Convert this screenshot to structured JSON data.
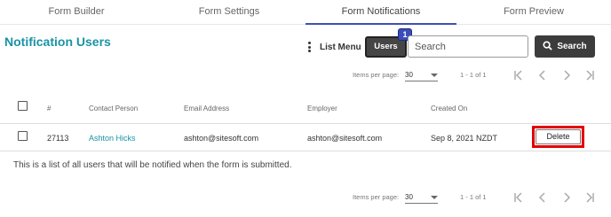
{
  "tabs": [
    {
      "label": "Form Builder",
      "active": false
    },
    {
      "label": "Form Settings",
      "active": false
    },
    {
      "label": "Form Notifications",
      "active": true
    },
    {
      "label": "Form Preview",
      "active": false
    }
  ],
  "page": {
    "title": "Notification Users"
  },
  "toolbar": {
    "list_menu_label": "List Menu",
    "users_label": "Users",
    "users_badge": "1",
    "search_placeholder": "Search",
    "search_value": "",
    "search_button_label": "Search"
  },
  "pagination_top": {
    "items_per_page_label": "Items per page:",
    "items_per_page": "30",
    "range": "1 - 1 of 1"
  },
  "pagination_bottom": {
    "items_per_page_label": "Items per page:",
    "items_per_page": "30",
    "range": "1 - 1 of 1"
  },
  "table": {
    "columns": [
      "#",
      "Contact Person",
      "Email Address",
      "Employer",
      "Created On"
    ],
    "rows": [
      {
        "id": "27113",
        "contact": "Ashton Hicks",
        "email": "ashton@sitesoft.com",
        "employer": "ashton@sitesoft.com",
        "created": "Sep 8, 2021 NZDT",
        "action": "Delete"
      }
    ]
  },
  "footer_note": "This is a list of all users that will be notified when the form is submitted.",
  "colors": {
    "accent": "#3f51b5",
    "title": "#1a93a6",
    "highlight": "#e30000"
  },
  "icons": [
    "kebab-menu-icon",
    "search-icon",
    "first-page-icon",
    "previous-page-icon",
    "next-page-icon",
    "last-page-icon",
    "dropdown-caret-icon"
  ]
}
